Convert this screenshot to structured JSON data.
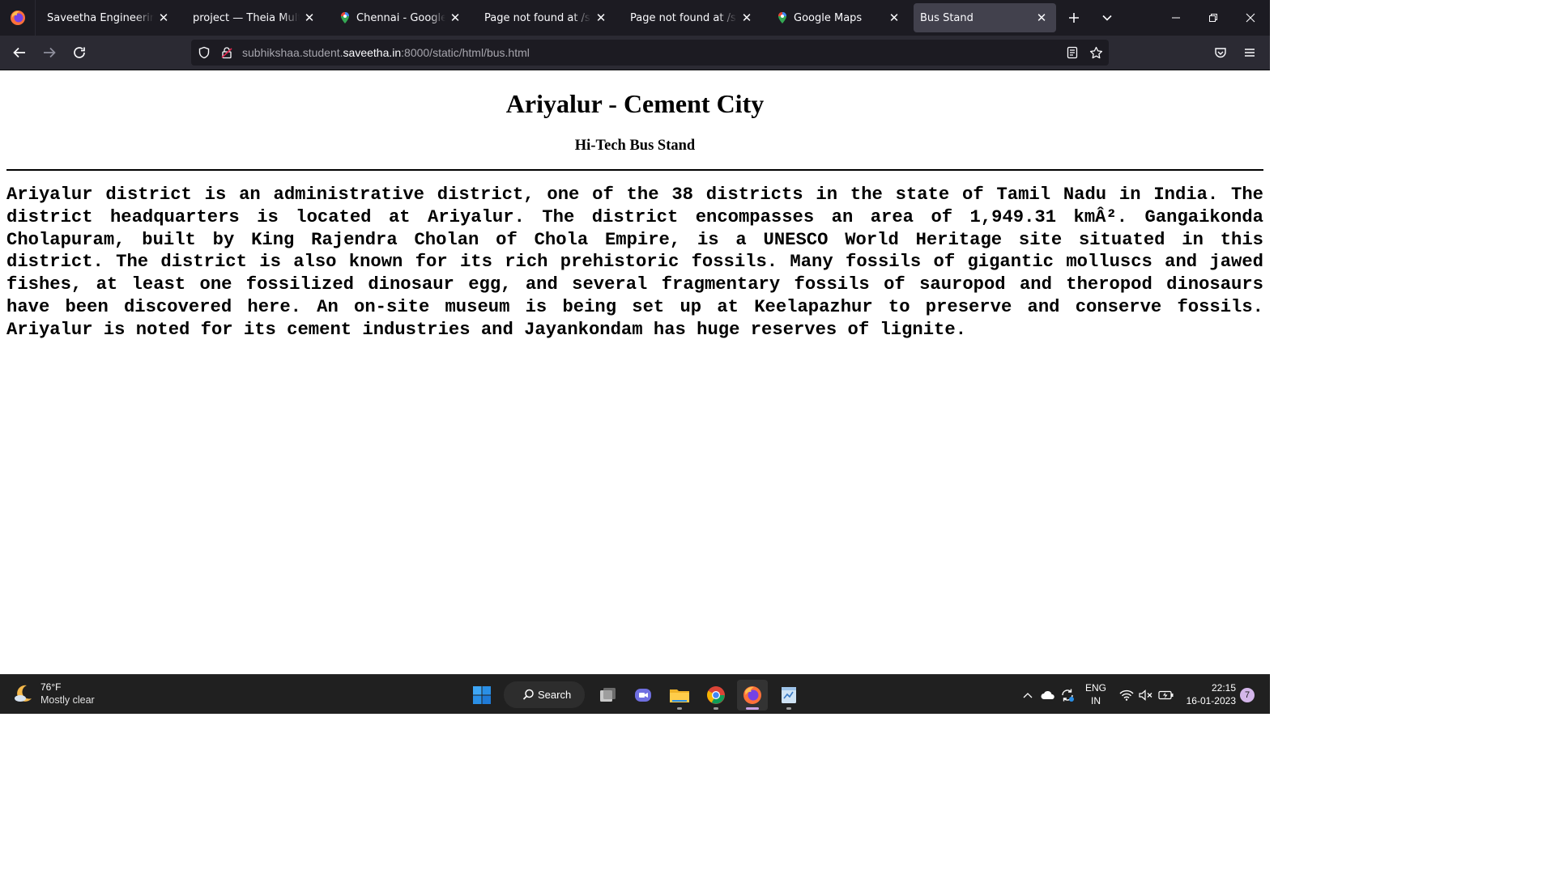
{
  "browser": {
    "tabs": [
      {
        "title": "Saveetha Engineering Colle",
        "icon": "page-icon"
      },
      {
        "title": "project — Theia Multi-Lang",
        "icon": "page-icon"
      },
      {
        "title": "Chennai - Google Maps",
        "icon": "maps-pin-icon"
      },
      {
        "title": "Page not found at /static/h",
        "icon": "page-icon"
      },
      {
        "title": "Page not found at /static/h",
        "icon": "page-icon"
      },
      {
        "title": "Google Maps",
        "icon": "maps-pin-icon"
      },
      {
        "title": "Bus Stand",
        "icon": "page-icon",
        "active": true
      }
    ],
    "url": {
      "prefix": "subhikshaa.student.",
      "host": "saveetha.in",
      "suffix": ":8000/static/html/bus.html"
    }
  },
  "page": {
    "title": "Ariyalur - Cement City",
    "subtitle": "Hi-Tech Bus Stand",
    "body": "Ariyalur district is an administrative district, one of the 38 districts in the state of Tamil Nadu in India. The district headquarters is located at Ariyalur. The district encompasses an area of 1,949.31 kmÂ². Gangaikonda Cholapuram, built by King Rajendra Cholan of Chola Empire, is a UNESCO World Heritage site situated in this district. The district is also known for its rich prehistoric fossils. Many fossils of gigantic molluscs and jawed fishes, at least one fossilized dinosaur egg, and several fragmentary fossils of sauropod and theropod dinosaurs have been discovered here. An on-site museum is being set up at Keelapazhur to preserve and conserve fossils. Ariyalur is noted for its cement industries and Jayankondam has huge reserves of lignite."
  },
  "taskbar": {
    "weather_temp": "76°F",
    "weather_desc": "Mostly clear",
    "search_label": "Search",
    "lang_top": "ENG",
    "lang_bottom": "IN",
    "time": "22:15",
    "date": "16-01-2023",
    "notification_count": "7"
  },
  "colors": {
    "tabstrip_bg": "#1c1b22",
    "navbar_bg": "#2b2a33",
    "active_tab_bg": "#42414d",
    "taskbar_bg": "#202020"
  }
}
